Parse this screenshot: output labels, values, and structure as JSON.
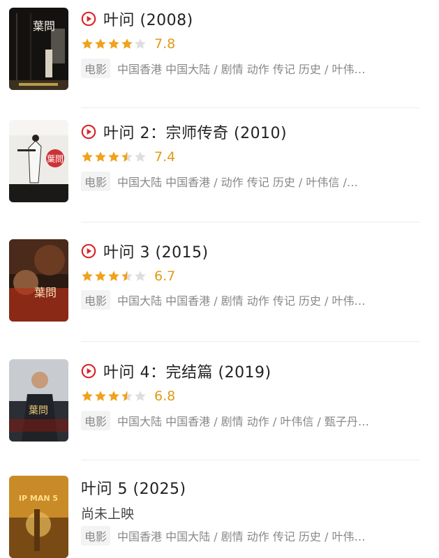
{
  "colors": {
    "star": "#f0a21c",
    "star_empty": "#dedede",
    "play": "#d9262c",
    "score": "#e09b15"
  },
  "movies": [
    {
      "title": "叶问 (2008)",
      "has_play": true,
      "rating_stars": 4,
      "score": "7.8",
      "tag": "电影",
      "meta": "中国香港 中国大陆 / 剧情 动作 传记 历史 / 叶伟…"
    },
    {
      "title": "叶问 2：宗师传奇 (2010)",
      "has_play": true,
      "rating_stars": 3.5,
      "score": "7.4",
      "tag": "电影",
      "meta": "中国大陆 中国香港 / 动作 传记 历史 / 叶伟信 /…"
    },
    {
      "title": "叶问 3 (2015)",
      "has_play": true,
      "rating_stars": 3.5,
      "score": "6.7",
      "tag": "电影",
      "meta": "中国大陆 中国香港 / 剧情 动作 传记 历史 / 叶伟…"
    },
    {
      "title": "叶问 4：完结篇 (2019)",
      "has_play": true,
      "rating_stars": 3.5,
      "score": "6.8",
      "tag": "电影",
      "meta": "中国大陆 中国香港 / 剧情 动作 / 叶伟信 / 甄子丹…"
    },
    {
      "title": "叶问 5 (2025)",
      "has_play": false,
      "status": "尚未上映",
      "tag": "电影",
      "meta": "中国香港 中国大陆 / 剧情 动作 传记 历史 / 叶伟…"
    }
  ],
  "posters": [
    {
      "name": "ip-man-2008-poster",
      "text": "葉問"
    },
    {
      "name": "ip-man-2-poster",
      "text": "葉問"
    },
    {
      "name": "ip-man-3-poster",
      "text": "葉問"
    },
    {
      "name": "ip-man-4-poster",
      "text": "葉問"
    },
    {
      "name": "ip-man-5-poster",
      "text": "IP MAN 5"
    }
  ]
}
